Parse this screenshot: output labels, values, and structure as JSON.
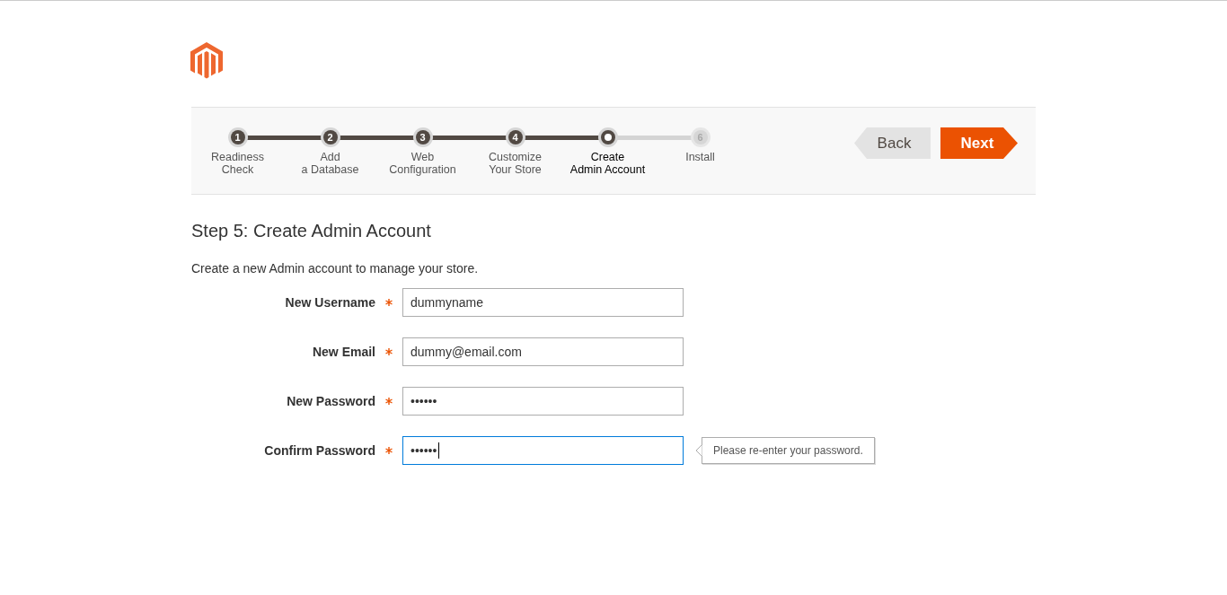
{
  "steps": [
    {
      "number": "1",
      "label": [
        "Readiness",
        "Check"
      ],
      "kind": "done"
    },
    {
      "number": "2",
      "label": [
        "Add",
        "a Database"
      ],
      "kind": "done"
    },
    {
      "number": "3",
      "label": [
        "Web",
        "Configuration"
      ],
      "kind": "done"
    },
    {
      "number": "4",
      "label": [
        "Customize",
        "Your Store"
      ],
      "kind": "done"
    },
    {
      "label": [
        "Create",
        "Admin Account"
      ],
      "kind": "current"
    },
    {
      "number": "6",
      "label": [
        "Install"
      ],
      "kind": "todo"
    }
  ],
  "buttons": {
    "back": "Back",
    "next": "Next"
  },
  "heading": "Step 5: Create Admin Account",
  "description": "Create a new Admin account to manage your store.",
  "fields": [
    {
      "label": "New Username",
      "required": true,
      "value": "dummyname",
      "focused": false
    },
    {
      "label": "New Email",
      "required": true,
      "value": "dummy@email.com",
      "focused": false
    },
    {
      "label": "New Password",
      "required": true,
      "value": "••••••",
      "focused": false
    },
    {
      "label": "Confirm Password",
      "required": true,
      "value": "••••••",
      "focused": true,
      "tooltip": "Please re-enter your password."
    }
  ]
}
